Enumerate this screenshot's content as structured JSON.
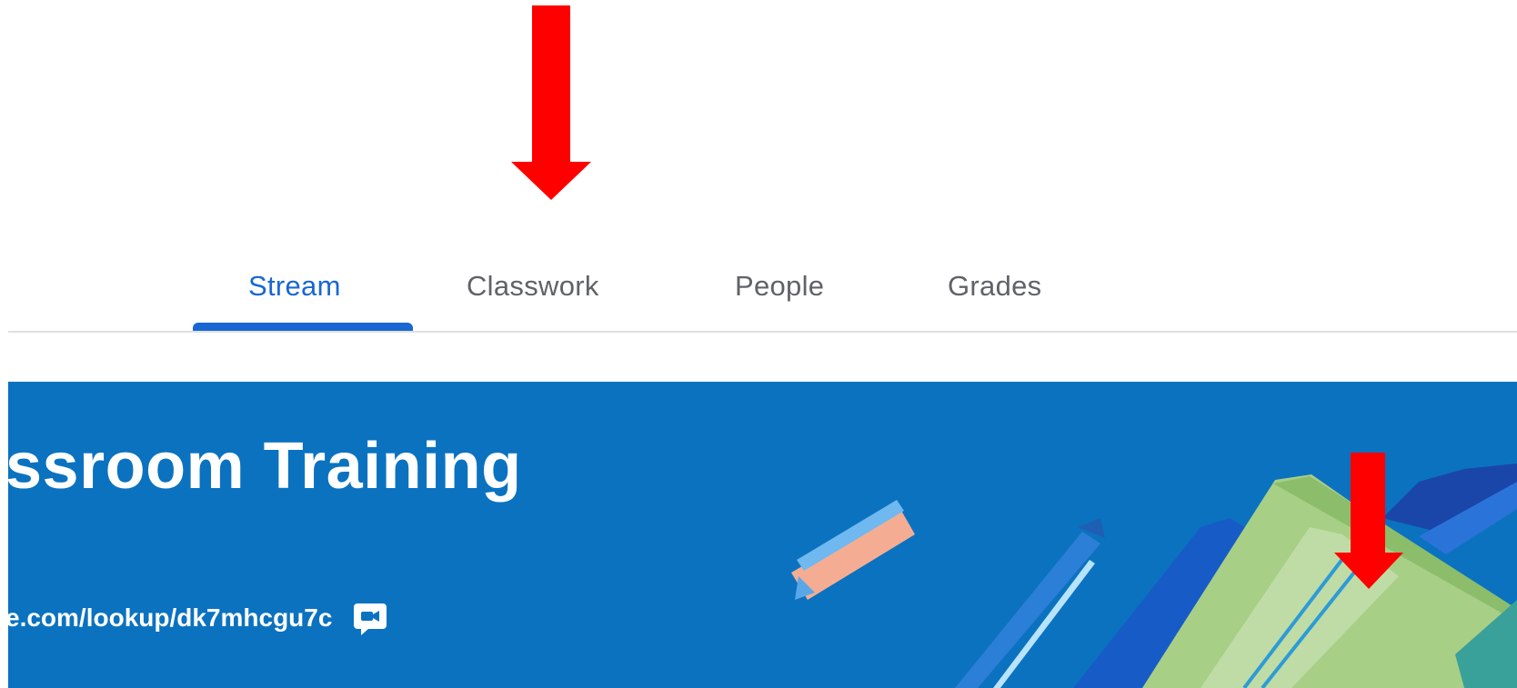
{
  "tabs": [
    {
      "label": "Stream",
      "active": true
    },
    {
      "label": "Classwork",
      "active": false
    },
    {
      "label": "People",
      "active": false
    },
    {
      "label": "Grades",
      "active": false
    }
  ],
  "banner": {
    "title": "ssroom Training",
    "meet_link": "e.com/lookup/dk7mhcgu7c",
    "meet_icon": "video-chat-icon"
  },
  "colors": {
    "accent": "#1967d2",
    "banner_background": "#0b72c0",
    "annotation_arrow": "#ff0000"
  }
}
